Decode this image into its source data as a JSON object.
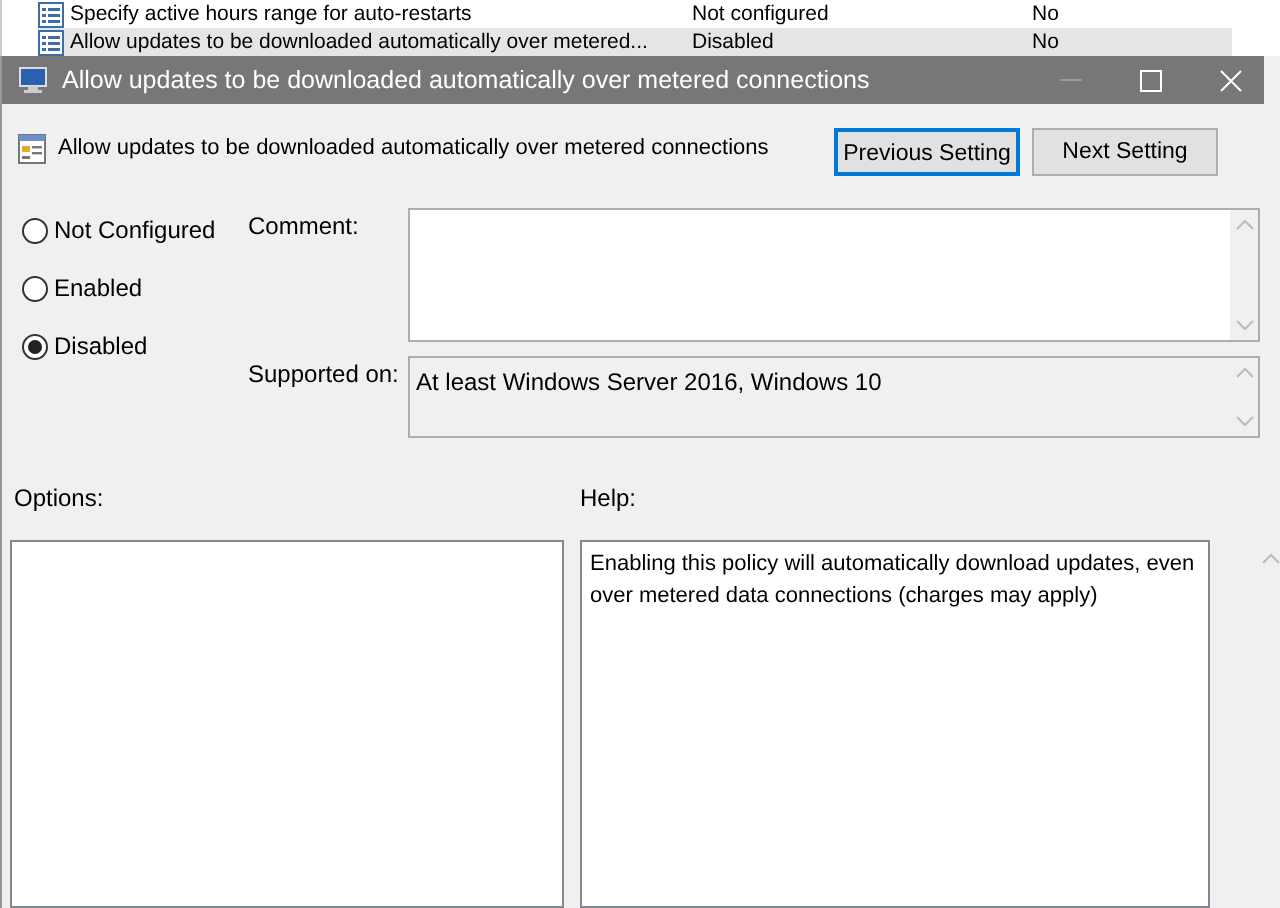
{
  "background_list": {
    "rows": [
      {
        "name": "Specify active hours range for auto-restarts",
        "state": "Not configured",
        "comment": "No",
        "selected": false
      },
      {
        "name": "Allow updates to be downloaded automatically over metered...",
        "state": "Disabled",
        "comment": "No",
        "selected": true
      }
    ]
  },
  "window": {
    "title": "Allow updates to be downloaded automatically over metered connections"
  },
  "header": {
    "setting_title": "Allow updates to be downloaded automatically over metered connections",
    "buttons": [
      {
        "label": "Previous Setting",
        "focused": true
      },
      {
        "label": "Next Setting",
        "focused": false
      }
    ]
  },
  "radios": [
    {
      "label": "Not Configured",
      "selected": false
    },
    {
      "label": "Enabled",
      "selected": false
    },
    {
      "label": "Disabled",
      "selected": true
    }
  ],
  "comment": {
    "label": "Comment:"
  },
  "supported_on": {
    "label": "Supported on:",
    "value": "At least Windows Server 2016, Windows 10"
  },
  "options": {
    "label": "Options:"
  },
  "help": {
    "label": "Help:",
    "text": "Enabling this policy will automatically download updates, even over metered data connections (charges may apply)"
  }
}
